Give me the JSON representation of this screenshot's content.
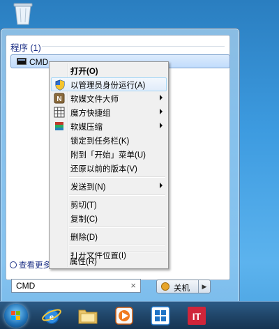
{
  "start_menu": {
    "group_header": "程序 (1)",
    "results": [
      {
        "label": "CMD",
        "icon": "cmd-icon"
      }
    ],
    "see_more_label": "查看更多",
    "search": {
      "value": "CMD",
      "clear_glyph": "×"
    },
    "shutdown": {
      "label": "关机",
      "arrow_glyph": "▶"
    }
  },
  "context_menu": {
    "items": [
      {
        "label": "打开(O)",
        "bold": true
      },
      {
        "label": "以管理员身份运行(A)",
        "icon": "uac-shield-icon",
        "hover": true
      },
      {
        "label": "软媒文件大师",
        "icon": "file-master-icon",
        "submenu": true
      },
      {
        "label": "魔方快捷组",
        "icon": "grid-icon",
        "submenu": true
      },
      {
        "label": "软媒压缩",
        "icon": "archive-icon",
        "submenu": true
      },
      {
        "label": "锁定到任务栏(K)"
      },
      {
        "label": "附到「开始」菜单(U)"
      },
      {
        "label": "还原以前的版本(V)"
      },
      {
        "label": "发送到(N)",
        "submenu": true
      },
      {
        "label": "剪切(T)"
      },
      {
        "label": "复制(C)"
      },
      {
        "label": "删除(D)"
      },
      {
        "label": "打开文件位置(I)"
      },
      {
        "label": "属性(R)"
      }
    ]
  },
  "taskbar": {
    "apps": [
      "start-orb",
      "internet-explorer-icon",
      "folder-icon",
      "media-player-icon",
      "windows-app-icon",
      "it-app-icon"
    ]
  },
  "colors": {
    "hover_border": "#a8d8f6",
    "taskbar": "#1f4467",
    "header_text": "#1e3287"
  }
}
